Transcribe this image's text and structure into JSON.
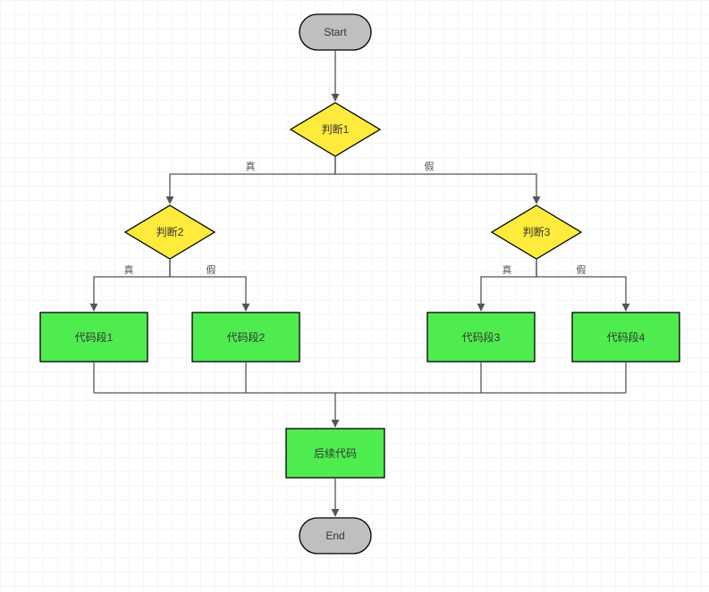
{
  "nodes": {
    "start": {
      "label": "Start"
    },
    "d1": {
      "label": "判断1"
    },
    "d2": {
      "label": "判断2"
    },
    "d3": {
      "label": "判断3"
    },
    "c1": {
      "label": "代码段1"
    },
    "c2": {
      "label": "代码段2"
    },
    "c3": {
      "label": "代码段3"
    },
    "c4": {
      "label": "代码段4"
    },
    "after": {
      "label": "后续代码"
    },
    "end": {
      "label": "End"
    }
  },
  "edges": {
    "d1_true": "真",
    "d1_false": "假",
    "d2_true": "真",
    "d2_false": "假",
    "d3_true": "真",
    "d3_false": "假"
  },
  "colors": {
    "terminal_fill": "#bfbfbf",
    "decision_fill": "#ffeb3b",
    "process_fill": "#4fec4f",
    "stroke": "#000000",
    "arrow": "#555555"
  }
}
